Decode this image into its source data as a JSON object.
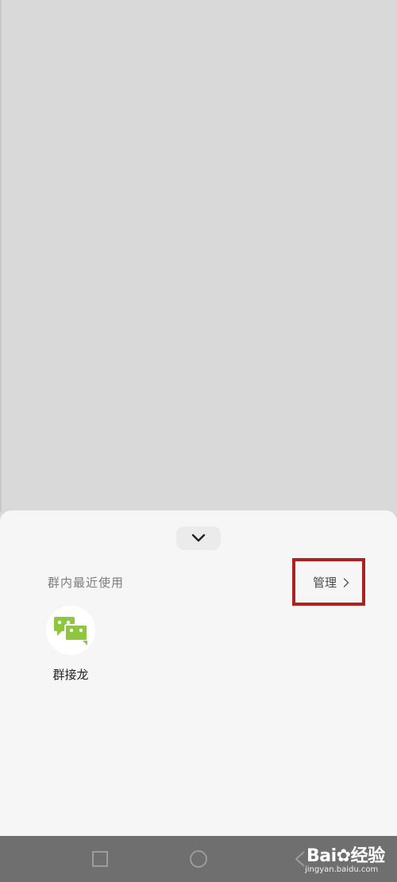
{
  "sheet": {
    "section_title": "群内最近使用",
    "manage_label": "管理",
    "highlight_color": "#b0201e",
    "apps": [
      {
        "label": "群接龙",
        "icon": "group-chat-icon",
        "icon_color": "#8ec63f"
      }
    ]
  },
  "navbar": {
    "buttons": [
      "recent-apps-icon",
      "home-icon",
      "back-icon"
    ]
  },
  "watermark": {
    "brand_prefix": "Bai",
    "brand_suffix": "经验",
    "sub": "jingyan.baidu.com"
  }
}
